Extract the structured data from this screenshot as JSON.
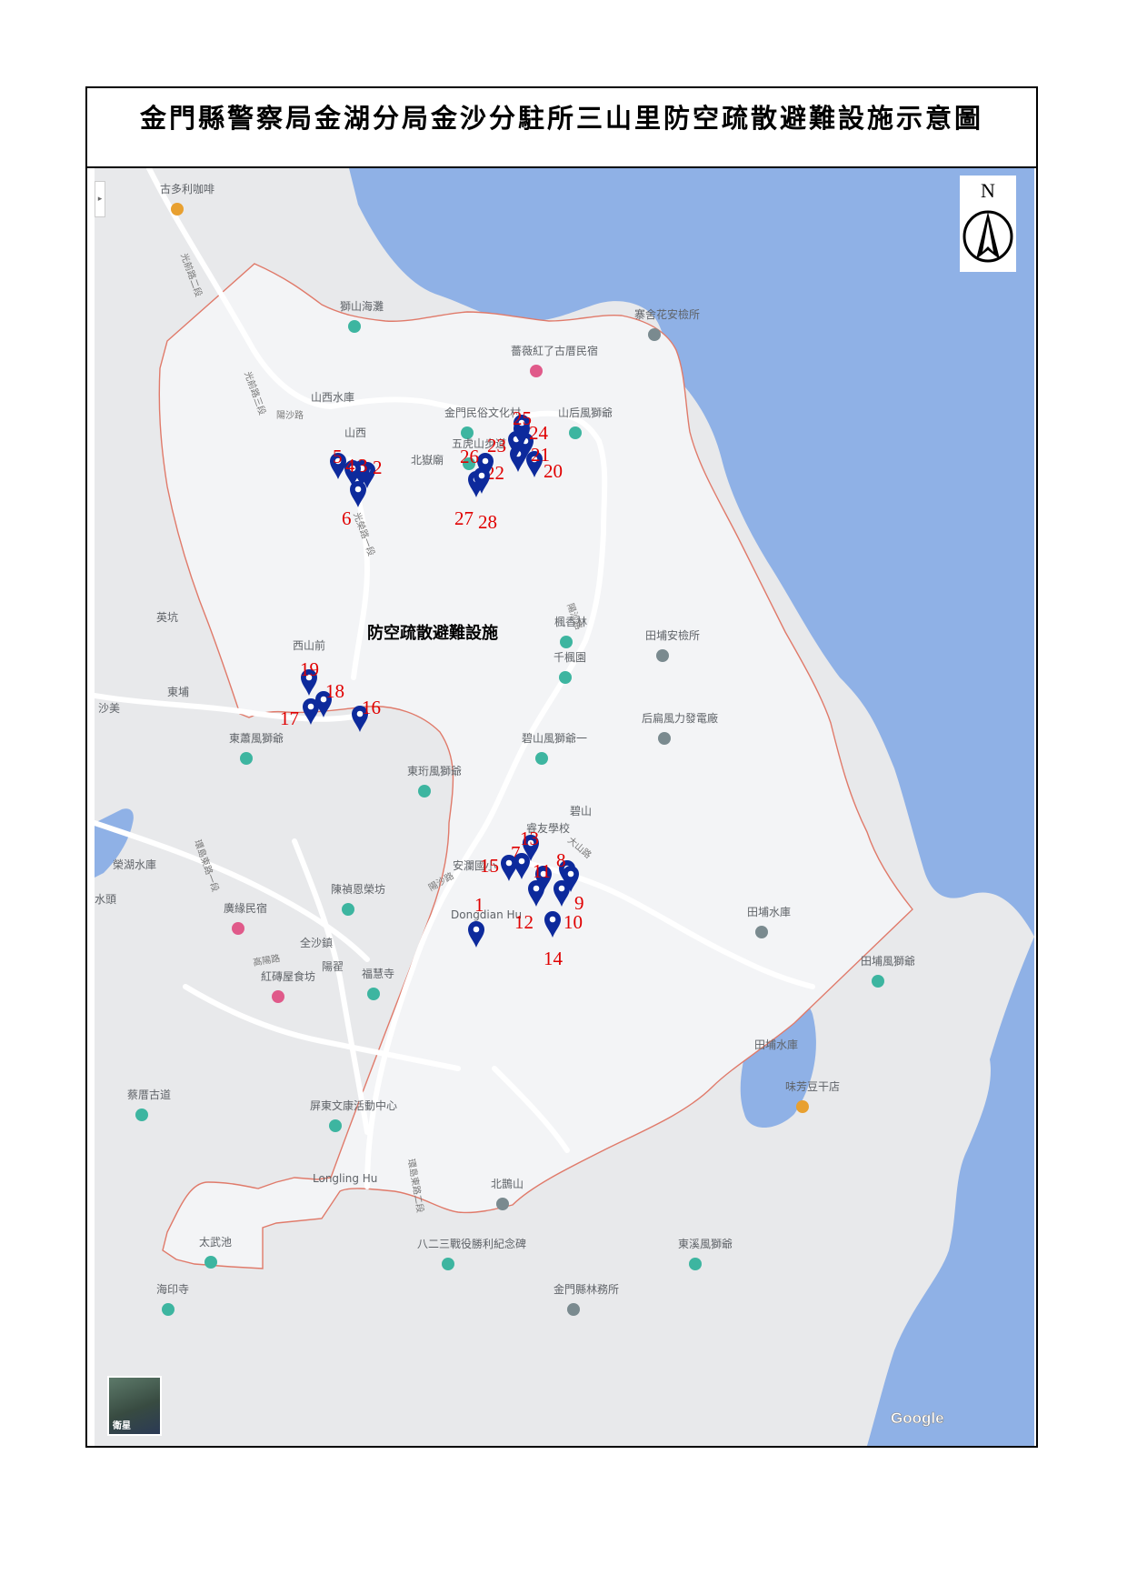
{
  "title": "金門縣警察局金湖分局金沙分駐所三山里防空疏散避難設施示意圖",
  "compass": {
    "letter": "N"
  },
  "area_label": "防空疏散避難設施",
  "place_labels": [
    {
      "id": "p1",
      "text": "古多利咖啡"
    },
    {
      "id": "p2",
      "text": "獅山海灘"
    },
    {
      "id": "p3",
      "text": "寨舍花安檢所"
    },
    {
      "id": "p4",
      "text": "薔薇紅了古厝民宿"
    },
    {
      "id": "p5",
      "text": "山西水庫"
    },
    {
      "id": "p6",
      "text": "金門民俗文化村"
    },
    {
      "id": "p7",
      "text": "山后風獅爺"
    },
    {
      "id": "p8",
      "text": "山西"
    },
    {
      "id": "p9",
      "text": "北嶽廟"
    },
    {
      "id": "p10",
      "text": "五虎山步道"
    },
    {
      "id": "p11",
      "text": "英坑"
    },
    {
      "id": "p12",
      "text": "西山前"
    },
    {
      "id": "p13",
      "text": "楓香林"
    },
    {
      "id": "p14",
      "text": "千楓園"
    },
    {
      "id": "p15",
      "text": "田埔安檢所"
    },
    {
      "id": "p16",
      "text": "東埔"
    },
    {
      "id": "p17",
      "text": "沙美"
    },
    {
      "id": "p18",
      "text": "東蕭風獅爺"
    },
    {
      "id": "p19",
      "text": "后扁風力發電廠"
    },
    {
      "id": "p20",
      "text": "碧山風獅爺一"
    },
    {
      "id": "p21",
      "text": "東珩風獅爺"
    },
    {
      "id": "p22",
      "text": "碧山"
    },
    {
      "id": "p23",
      "text": "睿友學校"
    },
    {
      "id": "p24",
      "text": "安瀾國小"
    },
    {
      "id": "p25",
      "text": "陳禎恩榮坊"
    },
    {
      "id": "p26",
      "text": "Dongdian Hu"
    },
    {
      "id": "p27",
      "text": "水頭"
    },
    {
      "id": "p28",
      "text": "廣緣民宿"
    },
    {
      "id": "p29",
      "text": "全沙鎮"
    },
    {
      "id": "p30",
      "text": "田埔水庫"
    },
    {
      "id": "p31",
      "text": "田埔風獅爺"
    },
    {
      "id": "p32",
      "text": "紅磚屋食坊"
    },
    {
      "id": "p33",
      "text": "陽翟"
    },
    {
      "id": "p34",
      "text": "福慧寺"
    },
    {
      "id": "p35",
      "text": "味芳豆干店"
    },
    {
      "id": "p36",
      "text": "蔡厝古道"
    },
    {
      "id": "p37",
      "text": "屏東文康活動中心"
    },
    {
      "id": "p38",
      "text": "Longling Hu"
    },
    {
      "id": "p39",
      "text": "北鵲山"
    },
    {
      "id": "p40",
      "text": "太武池"
    },
    {
      "id": "p41",
      "text": "八二三戰役勝利紀念碑"
    },
    {
      "id": "p42",
      "text": "東溪風獅爺"
    },
    {
      "id": "p43",
      "text": "海印寺"
    },
    {
      "id": "p44",
      "text": "金門縣林務所"
    },
    {
      "id": "p45",
      "text": "榮湖水庫"
    },
    {
      "id": "p46",
      "text": "田埔水庫"
    }
  ],
  "road_labels": [
    {
      "id": "r1",
      "text": "光前路二段"
    },
    {
      "id": "r2",
      "text": "光前路三段"
    },
    {
      "id": "r3",
      "text": "陽沙路"
    },
    {
      "id": "r4",
      "text": "光榮路一段"
    },
    {
      "id": "r5",
      "text": "陽沙路"
    },
    {
      "id": "r6",
      "text": "大山路"
    },
    {
      "id": "r7",
      "text": "環島東路一段"
    },
    {
      "id": "r8",
      "text": "環島東路二段"
    },
    {
      "id": "r9",
      "text": "高陽路"
    },
    {
      "id": "r10",
      "text": "陽沙路"
    }
  ],
  "shelters": [
    {
      "n": "1"
    },
    {
      "n": "2"
    },
    {
      "n": "3"
    },
    {
      "n": "4"
    },
    {
      "n": "5"
    },
    {
      "n": "6"
    },
    {
      "n": "7"
    },
    {
      "n": "8"
    },
    {
      "n": "9"
    },
    {
      "n": "10"
    },
    {
      "n": "11"
    },
    {
      "n": "12"
    },
    {
      "n": "13"
    },
    {
      "n": "14"
    },
    {
      "n": "15"
    },
    {
      "n": "16"
    },
    {
      "n": "17"
    },
    {
      "n": "18"
    },
    {
      "n": "19"
    },
    {
      "n": "20"
    },
    {
      "n": "21"
    },
    {
      "n": "22"
    },
    {
      "n": "23"
    },
    {
      "n": "24"
    },
    {
      "n": "25"
    },
    {
      "n": "26"
    },
    {
      "n": "27"
    },
    {
      "n": "28"
    }
  ],
  "satellite_label": "衛星",
  "attribution": "Google",
  "colors": {
    "sea": "#8fb1e6",
    "land": "#e8e9eb",
    "area": "#f3f4f6",
    "boundary": "#e07a6a",
    "pin": "#0d2a9c",
    "label_red": "#e00000"
  }
}
